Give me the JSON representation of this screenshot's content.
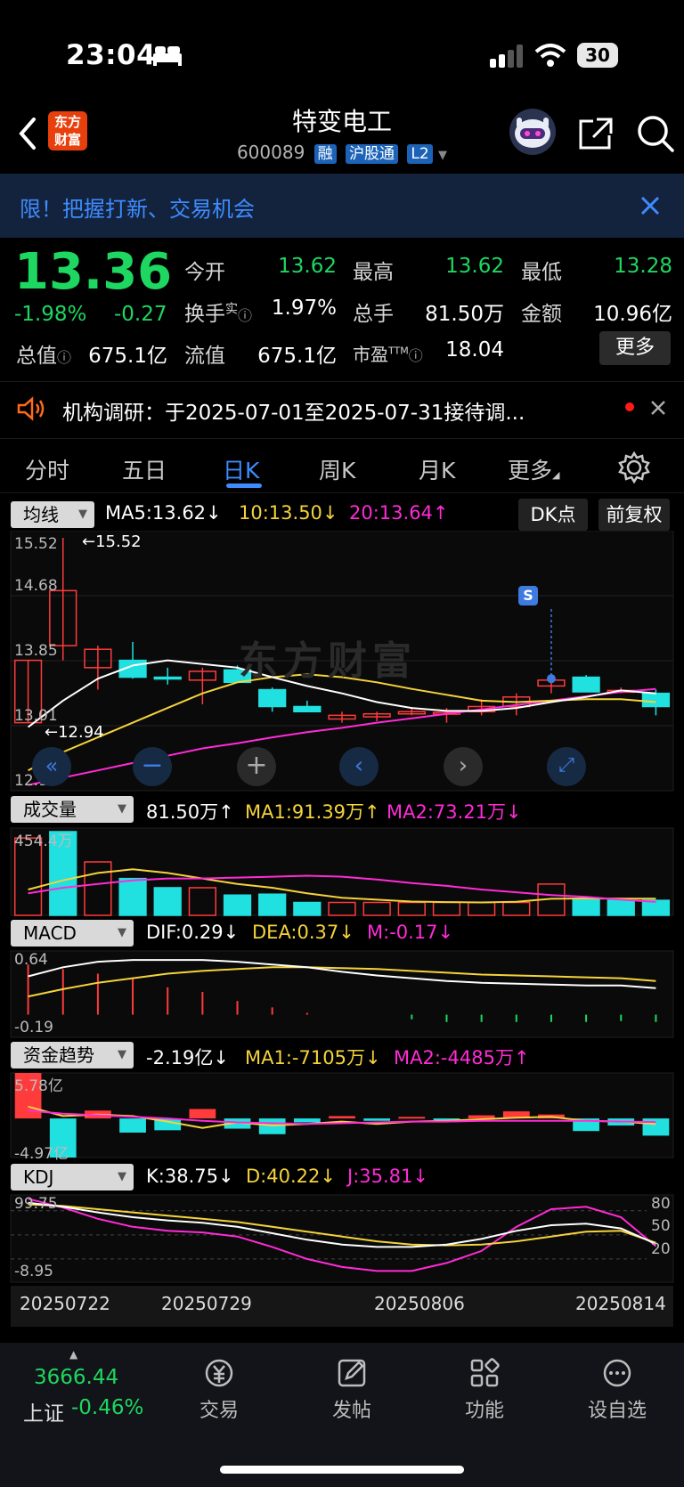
{
  "status_bar": {
    "time": "23:04",
    "battery": "30"
  },
  "header": {
    "title": "特变电工",
    "code": "600089",
    "tags": [
      "融",
      "沪股通",
      "L2"
    ],
    "logo_line1": "东方",
    "logo_line2": "财富"
  },
  "banner": {
    "text": "限！把握打新、交易机会"
  },
  "quote": {
    "price": "13.36",
    "change_pct": "-1.98%",
    "change": "-0.27",
    "open_label": "今开",
    "open": "13.62",
    "high_label": "最高",
    "high": "13.62",
    "low_label": "最低",
    "low": "13.28",
    "turnover_label": "换手",
    "turnover_sup": "实",
    "turnover": "1.97%",
    "volume_label": "总手",
    "volume": "81.50万",
    "amount_label": "金额",
    "amount": "10.96亿",
    "mcap_label": "总值",
    "mcap": "675.1亿",
    "float_label": "流值",
    "float": "675.1亿",
    "pe_label": "市盈",
    "pe_sup": "TTM",
    "pe": "18.04",
    "more": "更多"
  },
  "notice": {
    "text": "机构调研：于2025-07-01至2025-07-31接待调..."
  },
  "tabs": [
    "分时",
    "五日",
    "日K",
    "周K",
    "月K",
    "更多"
  ],
  "active_tab": "日K",
  "ma_bar": {
    "selector": "均线",
    "ma5": "MA5:13.62↓",
    "ma10": "10:13.50↓",
    "ma20": "20:13.64↑",
    "dk": "DK点",
    "adjust": "前复权"
  },
  "price_axis": [
    "15.52",
    "14.68",
    "13.85",
    "13.01",
    "12.17"
  ],
  "annotations": {
    "high": "←15.52",
    "low": "←12.94",
    "signal": "S",
    "watermark": "东方财富"
  },
  "volume_bar": {
    "selector": "成交量",
    "vol": "81.50万↑",
    "ma1": "MA1:91.39万↑",
    "ma2": "MA2:73.21万↓",
    "axis_top": "454.4万"
  },
  "macd_bar": {
    "selector": "MACD",
    "dif": "DIF:0.29↓",
    "dea": "DEA:0.37↓",
    "m": "M:-0.17↓",
    "axis_top": "0.64",
    "axis_bottom": "-0.19"
  },
  "fund_bar": {
    "selector": "资金趋势",
    "val": "-2.19亿↓",
    "ma1": "MA1:-7105万↓",
    "ma2": "MA2:-4485万↑",
    "axis_top": "5.78亿",
    "axis_bottom": "-4.97亿"
  },
  "kdj_bar": {
    "selector": "KDJ",
    "k": "K:38.75↓",
    "d": "D:40.22↓",
    "j": "J:35.81↓",
    "axis_top": "99.75",
    "axis_bottom": "-8.95",
    "levels": [
      "80",
      "50",
      "20"
    ]
  },
  "dates": [
    "20250722",
    "20250729",
    "20250806",
    "20250814"
  ],
  "bottom_nav": {
    "index_value": "3666.44",
    "index_name": "上证",
    "index_change": "-0.46%",
    "items": [
      "交易",
      "发帖",
      "功能",
      "设自选"
    ]
  },
  "colors": {
    "up": "#ff3b3b",
    "down": "#21e0e0",
    "ma5": "#ffffff",
    "ma10": "#f5d33b",
    "ma20": "#ff2bd6",
    "accent": "#3d8bff"
  },
  "chart_data": {
    "type": "candlestick",
    "ohlc": [
      {
        "o": 13.0,
        "h": 13.85,
        "l": 13.0,
        "c": 13.85
      },
      {
        "o": 14.05,
        "h": 15.52,
        "l": 13.85,
        "c": 14.8
      },
      {
        "o": 13.75,
        "h": 14.05,
        "l": 13.45,
        "c": 14.0
      },
      {
        "o": 13.85,
        "h": 14.1,
        "l": 13.6,
        "c": 13.62
      },
      {
        "o": 13.62,
        "h": 13.75,
        "l": 13.52,
        "c": 13.6
      },
      {
        "o": 13.58,
        "h": 13.75,
        "l": 13.25,
        "c": 13.7
      },
      {
        "o": 13.72,
        "h": 13.78,
        "l": 13.55,
        "c": 13.55
      },
      {
        "o": 13.45,
        "h": 13.48,
        "l": 13.15,
        "c": 13.22
      },
      {
        "o": 13.22,
        "h": 13.3,
        "l": 13.15,
        "c": 13.15
      },
      {
        "o": 13.05,
        "h": 13.15,
        "l": 13.0,
        "c": 13.1
      },
      {
        "o": 13.08,
        "h": 13.15,
        "l": 13.02,
        "c": 13.12
      },
      {
        "o": 13.12,
        "h": 13.2,
        "l": 13.1,
        "c": 13.15
      },
      {
        "o": 13.12,
        "h": 13.2,
        "l": 13.0,
        "c": 13.14
      },
      {
        "o": 13.15,
        "h": 13.32,
        "l": 13.1,
        "c": 13.22
      },
      {
        "o": 13.22,
        "h": 13.4,
        "l": 13.1,
        "c": 13.35
      },
      {
        "o": 13.5,
        "h": 13.62,
        "l": 13.4,
        "c": 13.58
      },
      {
        "o": 13.62,
        "h": 13.65,
        "l": 13.42,
        "c": 13.42
      },
      {
        "o": 13.44,
        "h": 13.48,
        "l": 13.4,
        "c": 13.44
      },
      {
        "o": 13.4,
        "h": 13.45,
        "l": 13.1,
        "c": 13.22
      }
    ],
    "ma5": [
      12.94,
      13.3,
      13.6,
      13.78,
      13.85,
      13.8,
      13.75,
      13.62,
      13.5,
      13.4,
      13.28,
      13.2,
      13.16,
      13.16,
      13.2,
      13.28,
      13.35,
      13.44,
      13.4
    ],
    "ma10": [
      12.35,
      12.6,
      12.8,
      13.0,
      13.2,
      13.4,
      13.55,
      13.62,
      13.66,
      13.62,
      13.55,
      13.46,
      13.38,
      13.3,
      13.28,
      13.3,
      13.32,
      13.32,
      13.28
    ],
    "ma20": [
      12.15,
      12.25,
      12.35,
      12.45,
      12.55,
      12.65,
      12.72,
      12.8,
      12.87,
      12.93,
      13.0,
      13.06,
      13.12,
      13.18,
      13.24,
      13.3,
      13.36,
      13.42,
      13.46
    ],
    "volume": [
      420,
      454.4,
      290,
      200,
      150,
      150,
      110,
      115,
      70,
      70,
      70,
      70,
      70,
      70,
      70,
      170,
      91,
      81.5,
      81.5
    ],
    "volume_up": [
      true,
      false,
      true,
      false,
      false,
      true,
      false,
      false,
      false,
      true,
      true,
      true,
      true,
      true,
      true,
      true,
      false,
      false,
      false
    ],
    "vol_ma1": [
      140,
      190,
      230,
      250,
      230,
      200,
      170,
      150,
      120,
      95,
      85,
      75,
      72,
      70,
      74,
      90,
      92,
      91,
      91
    ],
    "vol_ma2": [
      120,
      150,
      170,
      190,
      200,
      200,
      205,
      210,
      215,
      210,
      195,
      175,
      160,
      140,
      125,
      110,
      100,
      85,
      73
    ],
    "macd_hist": [
      0.55,
      0.5,
      0.45,
      0.4,
      0.3,
      0.25,
      0.15,
      0.08,
      0.02,
      0,
      0,
      -0.05,
      -0.08,
      -0.08,
      -0.08,
      -0.08,
      -0.08,
      -0.07,
      -0.08
    ],
    "dif": [
      0.42,
      0.52,
      0.58,
      0.6,
      0.6,
      0.6,
      0.58,
      0.55,
      0.52,
      0.47,
      0.43,
      0.4,
      0.37,
      0.35,
      0.34,
      0.33,
      0.32,
      0.32,
      0.29
    ],
    "dea": [
      0.2,
      0.28,
      0.35,
      0.4,
      0.45,
      0.48,
      0.5,
      0.52,
      0.52,
      0.51,
      0.5,
      0.48,
      0.46,
      0.44,
      0.43,
      0.42,
      0.41,
      0.4,
      0.37
    ],
    "fund_flow": [
      5.78,
      -4.97,
      1.0,
      -1.8,
      -1.5,
      1.2,
      -1.3,
      -2.0,
      -0.5,
      0.3,
      -0.3,
      0.2,
      -0.2,
      0.4,
      0.9,
      0.5,
      -1.6,
      -0.9,
      -2.19
    ],
    "fund_ma1": [
      1.5,
      0.3,
      0.5,
      0.3,
      -0.4,
      -1.2,
      -0.5,
      -0.9,
      -0.7,
      -0.4,
      -0.7,
      -0.4,
      -0.3,
      -0.1,
      0.1,
      0.2,
      -0.3,
      -0.4,
      -0.71
    ],
    "fund_ma2": [
      1.0,
      0.6,
      0.4,
      0.2,
      0.0,
      -0.3,
      -0.5,
      -0.6,
      -0.7,
      -0.6,
      -0.5,
      -0.4,
      -0.4,
      -0.3,
      -0.3,
      -0.3,
      -0.3,
      -0.4,
      -0.45
    ],
    "k": [
      90,
      85,
      78,
      72,
      68,
      65,
      60,
      52,
      44,
      38,
      35,
      35,
      38,
      45,
      55,
      62,
      64,
      58,
      38.75
    ],
    "d": [
      88,
      86,
      82,
      78,
      74,
      70,
      66,
      60,
      54,
      48,
      42,
      38,
      37,
      38,
      42,
      48,
      54,
      55,
      40.22
    ],
    "j": [
      95,
      84,
      70,
      60,
      55,
      53,
      48,
      35,
      20,
      10,
      5,
      5,
      15,
      30,
      60,
      82,
      85,
      72,
      35.81
    ],
    "kdj_range": [
      -8.95,
      99.75
    ]
  }
}
